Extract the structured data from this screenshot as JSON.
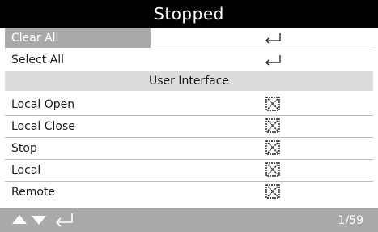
{
  "header": {
    "status_title": "Stopped"
  },
  "actions": [
    {
      "label": "Clear All",
      "icon": "enter-return-icon",
      "selected": true
    },
    {
      "label": "Select All",
      "icon": "enter-return-icon",
      "selected": false
    }
  ],
  "section": {
    "title": "User Interface"
  },
  "options": [
    {
      "label": "Local Open",
      "checked": true
    },
    {
      "label": "Local Close",
      "checked": true
    },
    {
      "label": "Stop",
      "checked": true
    },
    {
      "label": "Local",
      "checked": true
    },
    {
      "label": "Remote",
      "checked": true
    }
  ],
  "footer": {
    "page_indicator": "1/59",
    "nav_icons": [
      "up-arrow-icon",
      "down-arrow-icon",
      "enter-return-icon"
    ]
  },
  "colors": {
    "title_bg": "#000000",
    "selected_bg": "#a9a9a9",
    "section_bg": "#dcdcdc",
    "footer_bg": "#a9a9a9"
  }
}
